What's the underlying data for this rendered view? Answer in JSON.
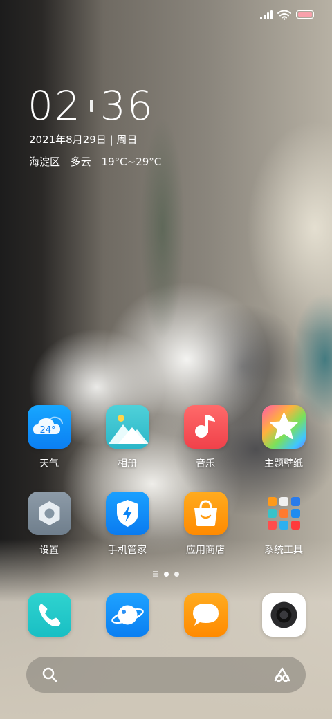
{
  "status": {
    "signal_bars": 4,
    "battery_color": "#f7a1ab"
  },
  "clock": {
    "hours": "02",
    "minutes": "36"
  },
  "date": {
    "text": "2021年8月29日 | 周日"
  },
  "weather": {
    "district": "海淀区",
    "condition": "多云",
    "temp_range": "19°C~29°C",
    "icon_temp": "24°"
  },
  "apps_row1": [
    {
      "label": "天气",
      "icon": "weather-icon"
    },
    {
      "label": "相册",
      "icon": "gallery-icon"
    },
    {
      "label": "音乐",
      "icon": "music-icon"
    },
    {
      "label": "主题壁纸",
      "icon": "themes-icon"
    }
  ],
  "apps_row2": [
    {
      "label": "设置",
      "icon": "settings-icon"
    },
    {
      "label": "手机管家",
      "icon": "security-icon"
    },
    {
      "label": "应用商店",
      "icon": "app-store-icon"
    },
    {
      "label": "系统工具",
      "icon": "folder-icon"
    }
  ],
  "dock": [
    {
      "icon": "phone-icon"
    },
    {
      "icon": "browser-icon"
    },
    {
      "icon": "messages-icon"
    },
    {
      "icon": "camera-icon"
    }
  ],
  "page_indicator": {
    "pages": 2,
    "current": 0
  },
  "search": {
    "icon": "search-icon",
    "assistant_icon": "assistant-icon"
  }
}
